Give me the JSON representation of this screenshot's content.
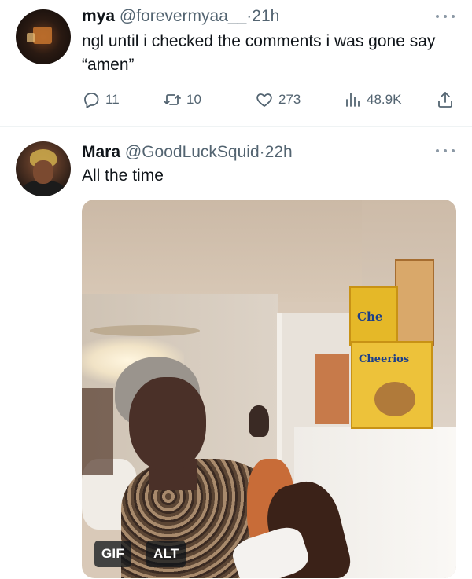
{
  "tweets": [
    {
      "author": {
        "name": "mya",
        "handle": "@forevermyaa__",
        "time": "21h"
      },
      "text": "ngl until i checked the comments i was gone say “amen”",
      "actions": {
        "replies": "11",
        "retweets": "10",
        "likes": "273",
        "views": "48.9K"
      }
    },
    {
      "author": {
        "name": "Mara",
        "handle": "@GoodLuckSquid",
        "time": "22h"
      },
      "text": "All the time",
      "media": {
        "gif_badge": "GIF",
        "alt_badge": "ALT",
        "box_label_1": "Che",
        "box_label_2": "Cheerios"
      }
    }
  ],
  "separator": "·",
  "icons": [
    "more-icon",
    "reply-icon",
    "retweet-icon",
    "like-icon",
    "views-icon",
    "share-icon"
  ],
  "colors": {
    "text": "#0f1419",
    "secondary": "#536471",
    "divider": "#eff3f4"
  }
}
